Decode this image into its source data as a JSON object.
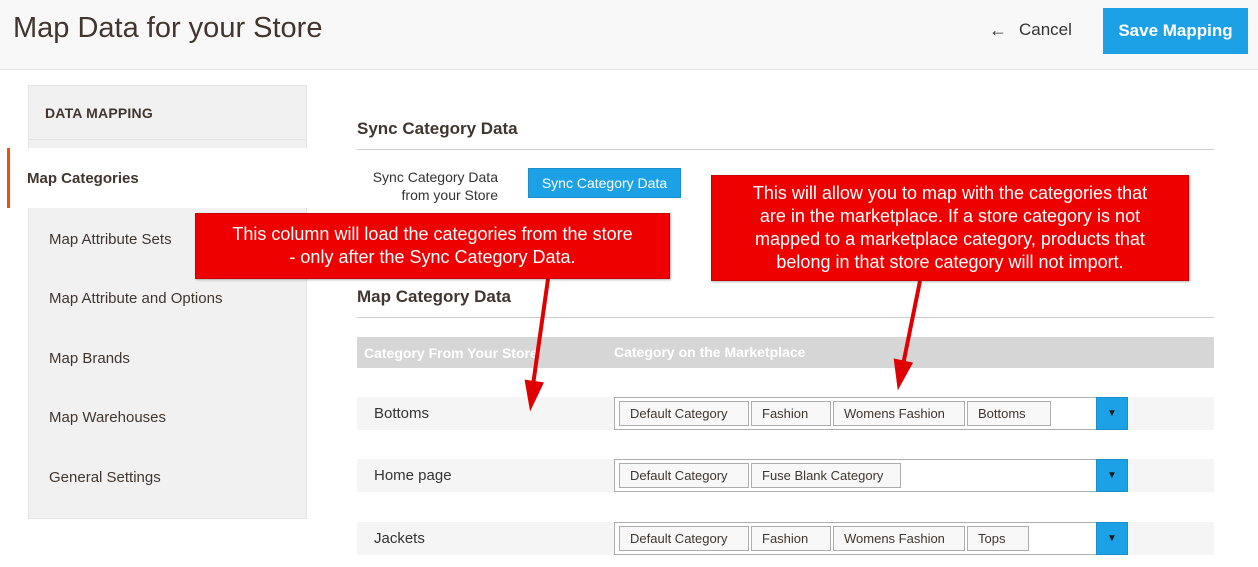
{
  "header": {
    "title": "Map Data for your Store",
    "cancel_label": "Cancel",
    "save_label": "Save Mapping"
  },
  "sidebar": {
    "title": "DATA MAPPING",
    "items": [
      {
        "label": "Map Categories",
        "active": true
      },
      {
        "label": "Map Attribute Sets",
        "active": false
      },
      {
        "label": "Map Attribute and Options",
        "active": false
      },
      {
        "label": "Map Brands",
        "active": false
      },
      {
        "label": "Map Warehouses",
        "active": false
      },
      {
        "label": "General Settings",
        "active": false
      }
    ]
  },
  "sync": {
    "section_title": "Sync Category Data",
    "field_label_line1": "Sync Category Data",
    "field_label_line2": "from your Store",
    "button_label": "Sync Category Data"
  },
  "mapping": {
    "section_title": "Map Category Data",
    "col_store": "Category From Your Store",
    "col_market": "Category on the Marketplace",
    "rows": [
      {
        "store": "Bottoms",
        "tags": [
          "Default Category",
          "Fashion",
          "Womens Fashion",
          "Bottoms"
        ]
      },
      {
        "store": "Home page",
        "tags": [
          "Default Category",
          "Fuse Blank Category"
        ]
      },
      {
        "store": "Jackets",
        "tags": [
          "Default Category",
          "Fashion",
          "Womens Fashion",
          "Tops"
        ]
      }
    ]
  },
  "callouts": {
    "left_line1": "This column will load the categories from the store",
    "left_line2": "- only after the Sync Category Data.",
    "right_line1": "This will allow you to map with the categories that",
    "right_line2": "are in the marketplace. If a store category is not",
    "right_line3": "mapped to a marketplace category, products that",
    "right_line4": "belong in that store category will not import."
  },
  "colors": {
    "accent": "#1da1e6",
    "active_border": "#eb5202",
    "callout": "#ee0000"
  },
  "icons": {
    "cancel": "arrow-left-icon",
    "dropdown": "caret-down-icon"
  }
}
